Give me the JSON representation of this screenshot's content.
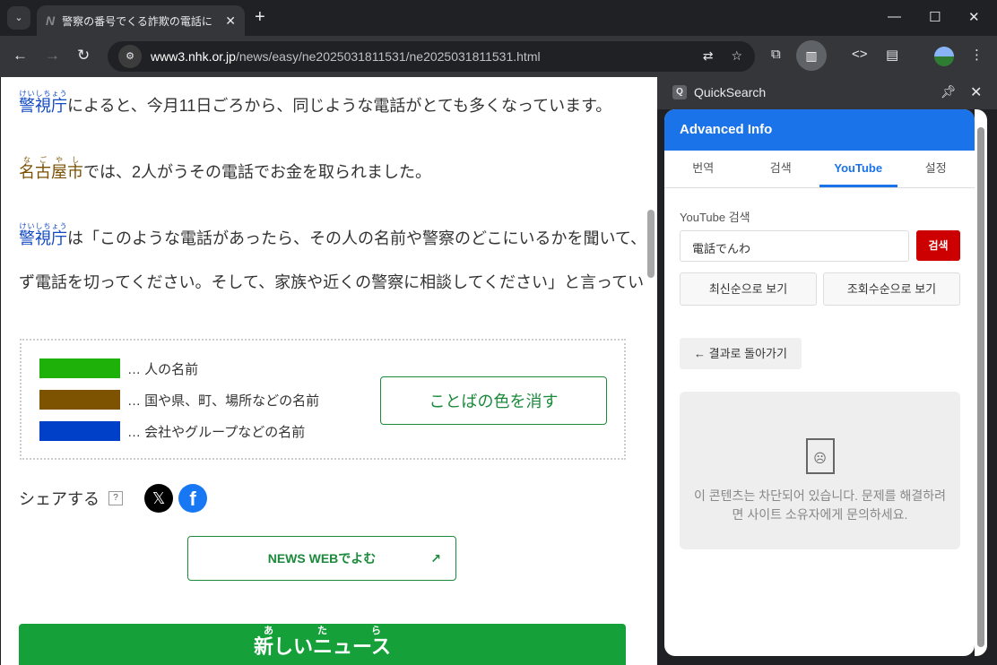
{
  "browser": {
    "tab_title": "警察の番号でくる詐欺の電話に",
    "url_host": "www3.nhk.or.jp",
    "url_path": "/news/easy/ne2025031811531/ne2025031811531.html"
  },
  "article": {
    "p1_a": "警視庁",
    "p1_a_ruby": "けいしちょう",
    "p1_b": "によると、今月11日ごろから、同じような電話がとても多くなっています。",
    "p2_a": "名古屋市",
    "p2_a_ruby": "なごやし",
    "p2_b": "では、2人がうその電話でお金を取られました。",
    "p3_a": "警視庁",
    "p3_a_ruby": "けいしちょう",
    "p3_b": "は「このような電話があったら、その人の名前や警察のどこにいるかを聞いて、必",
    "p3_c": "ず電話を切ってください。そして、家族や近くの警察に相談してください」と言っています。"
  },
  "legend": {
    "items": [
      {
        "label": "… 人の名前",
        "color": "#1eb10a"
      },
      {
        "label": "… 国や県、町、場所などの名前",
        "color": "#7d5200"
      },
      {
        "label": "… 会社やグループなどの名前",
        "color": "#0040c8"
      }
    ],
    "clear_button": "ことばの色を消す"
  },
  "share": {
    "label": "シェアする",
    "help": "?",
    "x": "𝕏",
    "facebook": "f"
  },
  "news_web": "NEWS WEBでよむ",
  "new_news": {
    "ruby": "あたら",
    "label": "新しいニュース"
  },
  "sidepanel": {
    "title": "QuickSearch",
    "header": "Advanced Info",
    "tabs": [
      "번역",
      "검색",
      "YouTube",
      "설정"
    ],
    "search_label": "YouTube 검색",
    "search_value": "電話でんわ",
    "search_button": "검색",
    "sort_latest": "최신순으로 보기",
    "sort_views": "조회수순으로 보기",
    "back": "← 결과로 돌아가기",
    "blocked_msg": "이 콘텐츠는 차단되어 있습니다. 문제를 해결하려면 사이트 소유자에게 문의하세요."
  }
}
